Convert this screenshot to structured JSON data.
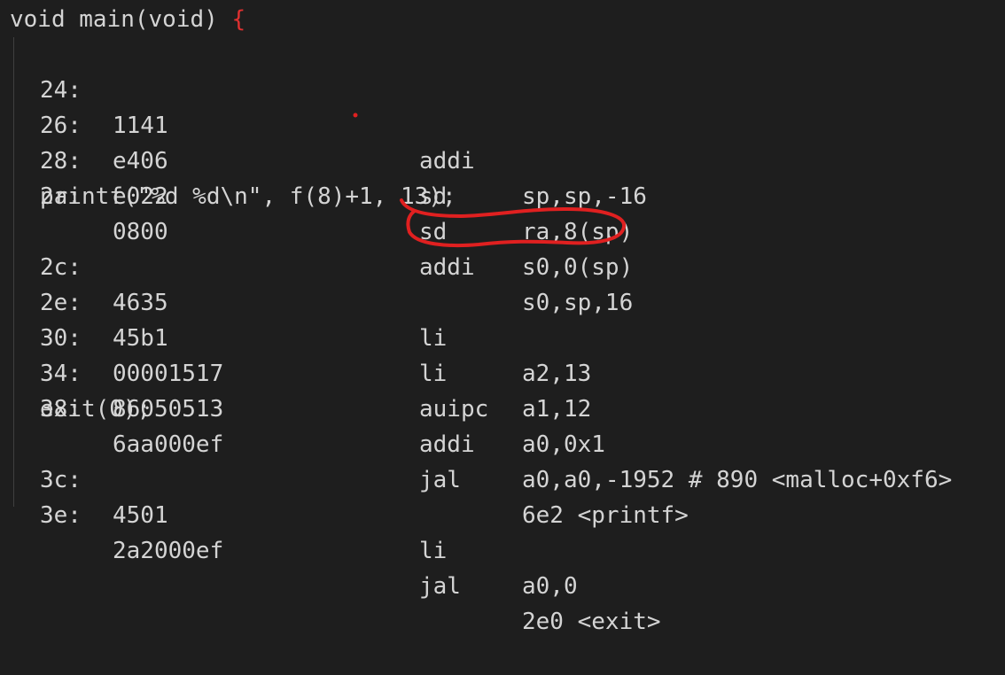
{
  "header": {
    "signature": "void main(void) ",
    "brace": "{"
  },
  "source_lines": {
    "printf": "printf(\"%d %d\\n\", f(8)+1, 13);",
    "exit": "exit(0);"
  },
  "instructions": [
    {
      "addr": "24:",
      "hex": "1141",
      "mnemonic": "addi",
      "operands": "sp,sp,-16"
    },
    {
      "addr": "26:",
      "hex": "e406",
      "mnemonic": "sd",
      "operands": "ra,8(sp)"
    },
    {
      "addr": "28:",
      "hex": "e022",
      "mnemonic": "sd",
      "operands": "s0,0(sp)"
    },
    {
      "addr": "2a:",
      "hex": "0800",
      "mnemonic": "addi",
      "operands": "s0,sp,16"
    },
    {
      "addr": "2c:",
      "hex": "4635",
      "mnemonic": "li",
      "operands": "a2,13"
    },
    {
      "addr": "2e:",
      "hex": "45b1",
      "mnemonic": "li",
      "operands": "a1,12"
    },
    {
      "addr": "30:",
      "hex": "00001517",
      "mnemonic": "auipc",
      "operands": "a0,0x1"
    },
    {
      "addr": "34:",
      "hex": "86050513",
      "mnemonic": "addi",
      "operands": "a0,a0,-1952 # 890 <malloc+0xf6>"
    },
    {
      "addr": "38:",
      "hex": "6aa000ef",
      "mnemonic": "jal",
      "operands": "6e2 <printf>"
    },
    {
      "addr": "3c:",
      "hex": "4501",
      "mnemonic": "li",
      "operands": "a0,0"
    },
    {
      "addr": "3e:",
      "hex": "2a2000ef",
      "mnemonic": "jal",
      "operands": "2e0 <exit>"
    }
  ],
  "colors": {
    "background": "#1e1e1e",
    "text": "#d4d4d4",
    "brace": "#e03030",
    "annotation": "#e02020"
  }
}
